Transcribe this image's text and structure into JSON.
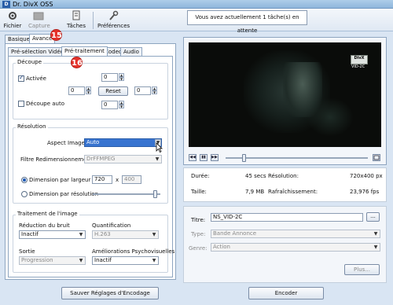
{
  "window": {
    "title": "Dr. DivX OSS"
  },
  "toolbar": {
    "items": [
      {
        "label": "Fichier",
        "icon": "gear-icon",
        "enabled": true
      },
      {
        "label": "Capture",
        "icon": "folder-icon",
        "enabled": false
      },
      {
        "label": "Tâches",
        "icon": "tasks-icon",
        "enabled": true
      },
      {
        "label": "Préférences",
        "icon": "wrench-icon",
        "enabled": true
      }
    ],
    "status": "Vous avez actuellement 1 tâche(s) en attente"
  },
  "mode_tabs": [
    "Basique",
    "Avancé"
  ],
  "badges": {
    "b15": "15",
    "b16": "16"
  },
  "sub_tabs": [
    "Pré-sélection Vidéo",
    "Pré-traitement",
    "Codec",
    "Audio"
  ],
  "decoupe": {
    "legend": "Découpe",
    "activee_label": "Activée",
    "activee_checked": true,
    "top": "0",
    "left": "0",
    "right": "0",
    "bottom": "0",
    "reset_label": "Reset",
    "auto_label": "Découpe auto",
    "auto_checked": false
  },
  "resolution": {
    "legend": "Résolution",
    "aspect_label": "Aspect Image",
    "aspect_value": "Auto",
    "filtre_label": "Filtre Redimensionnement",
    "filtre_value": "DrFFMPEG",
    "dim_largeur_label": "Dimension par largeur",
    "largeur": "720",
    "times": "x",
    "hauteur": "400",
    "dim_resolution_label": "Dimension par résolution",
    "resolution_slider": 0.95
  },
  "traitement": {
    "legend": "Traitement de l'image",
    "bruit_label": "Réduction du bruit",
    "bruit_value": "Inactif",
    "quant_label": "Quantification",
    "quant_value": "H.263",
    "sortie_label": "Sortie",
    "sortie_value": "Progression",
    "psycho_label": "Améliorations Psychovisuelles",
    "psycho_value": "Inactif"
  },
  "player": {
    "logo": "DivX",
    "code": "VID-2C",
    "buttons": [
      "◀◀",
      "▮▮",
      "▶▶"
    ],
    "position": 0.12
  },
  "info": {
    "duree_label": "Durée:",
    "duree_value": "45 secs",
    "resolution_label": "Résolution:",
    "resolution_value": "720x400 px",
    "taille_label": "Taille:",
    "taille_value": "7,9 MB",
    "rafraich_label": "Rafraîchissement:",
    "rafraich_value": "23,976 fps"
  },
  "meta": {
    "titre_label": "Titre:",
    "titre_value": "NS_VID-2C",
    "browse_label": "...",
    "type_label": "Type:",
    "type_value": "Bande Annonce",
    "genre_label": "Genre:",
    "genre_value": "Action",
    "plus_label": "Plus..."
  },
  "footer": {
    "save_label": "Sauver Réglages d'Encodage",
    "encode_label": "Encoder"
  }
}
